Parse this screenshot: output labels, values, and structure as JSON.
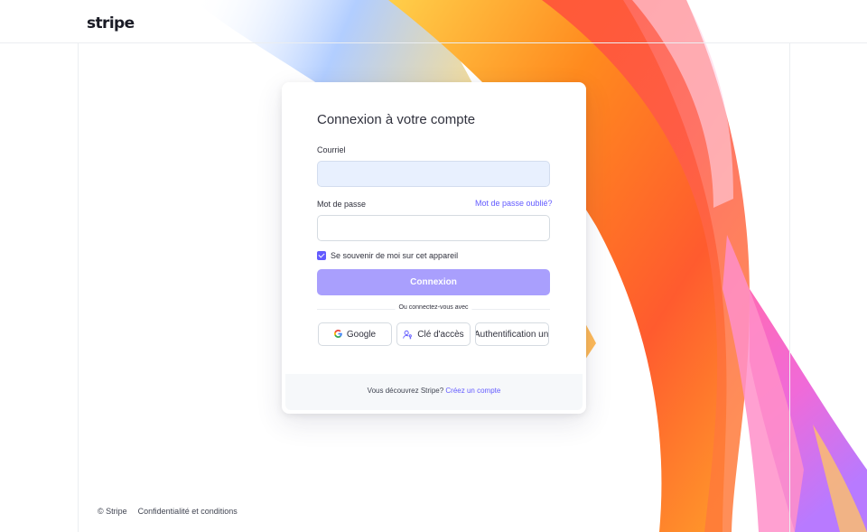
{
  "header": {
    "logo": "stripe"
  },
  "login": {
    "title": "Connexion à votre compte",
    "email_label": "Courriel",
    "email_value": "",
    "password_label": "Mot de passe",
    "password_value": "",
    "forgot_link": "Mot de passe oublié?",
    "remember_label": "Se souvenir de moi sur cet appareil",
    "remember_checked": true,
    "submit_label": "Connexion",
    "divider_text": "Ou connectez-vous avec",
    "alt_methods": [
      {
        "label": "Google",
        "icon": "google-icon"
      },
      {
        "label": "Clé d'accès",
        "icon": "passkey-icon"
      },
      {
        "label": "Authentification un",
        "icon": ""
      }
    ],
    "footer_prompt": "Vous découvrez Stripe?",
    "footer_link": "Créez un compte"
  },
  "page_footer": {
    "copyright": "© Stripe",
    "privacy": "Confidentialité et conditions"
  },
  "colors": {
    "accent": "#635bff",
    "button_disabled": "#a99ffd",
    "email_fill": "#e8f0fe"
  }
}
